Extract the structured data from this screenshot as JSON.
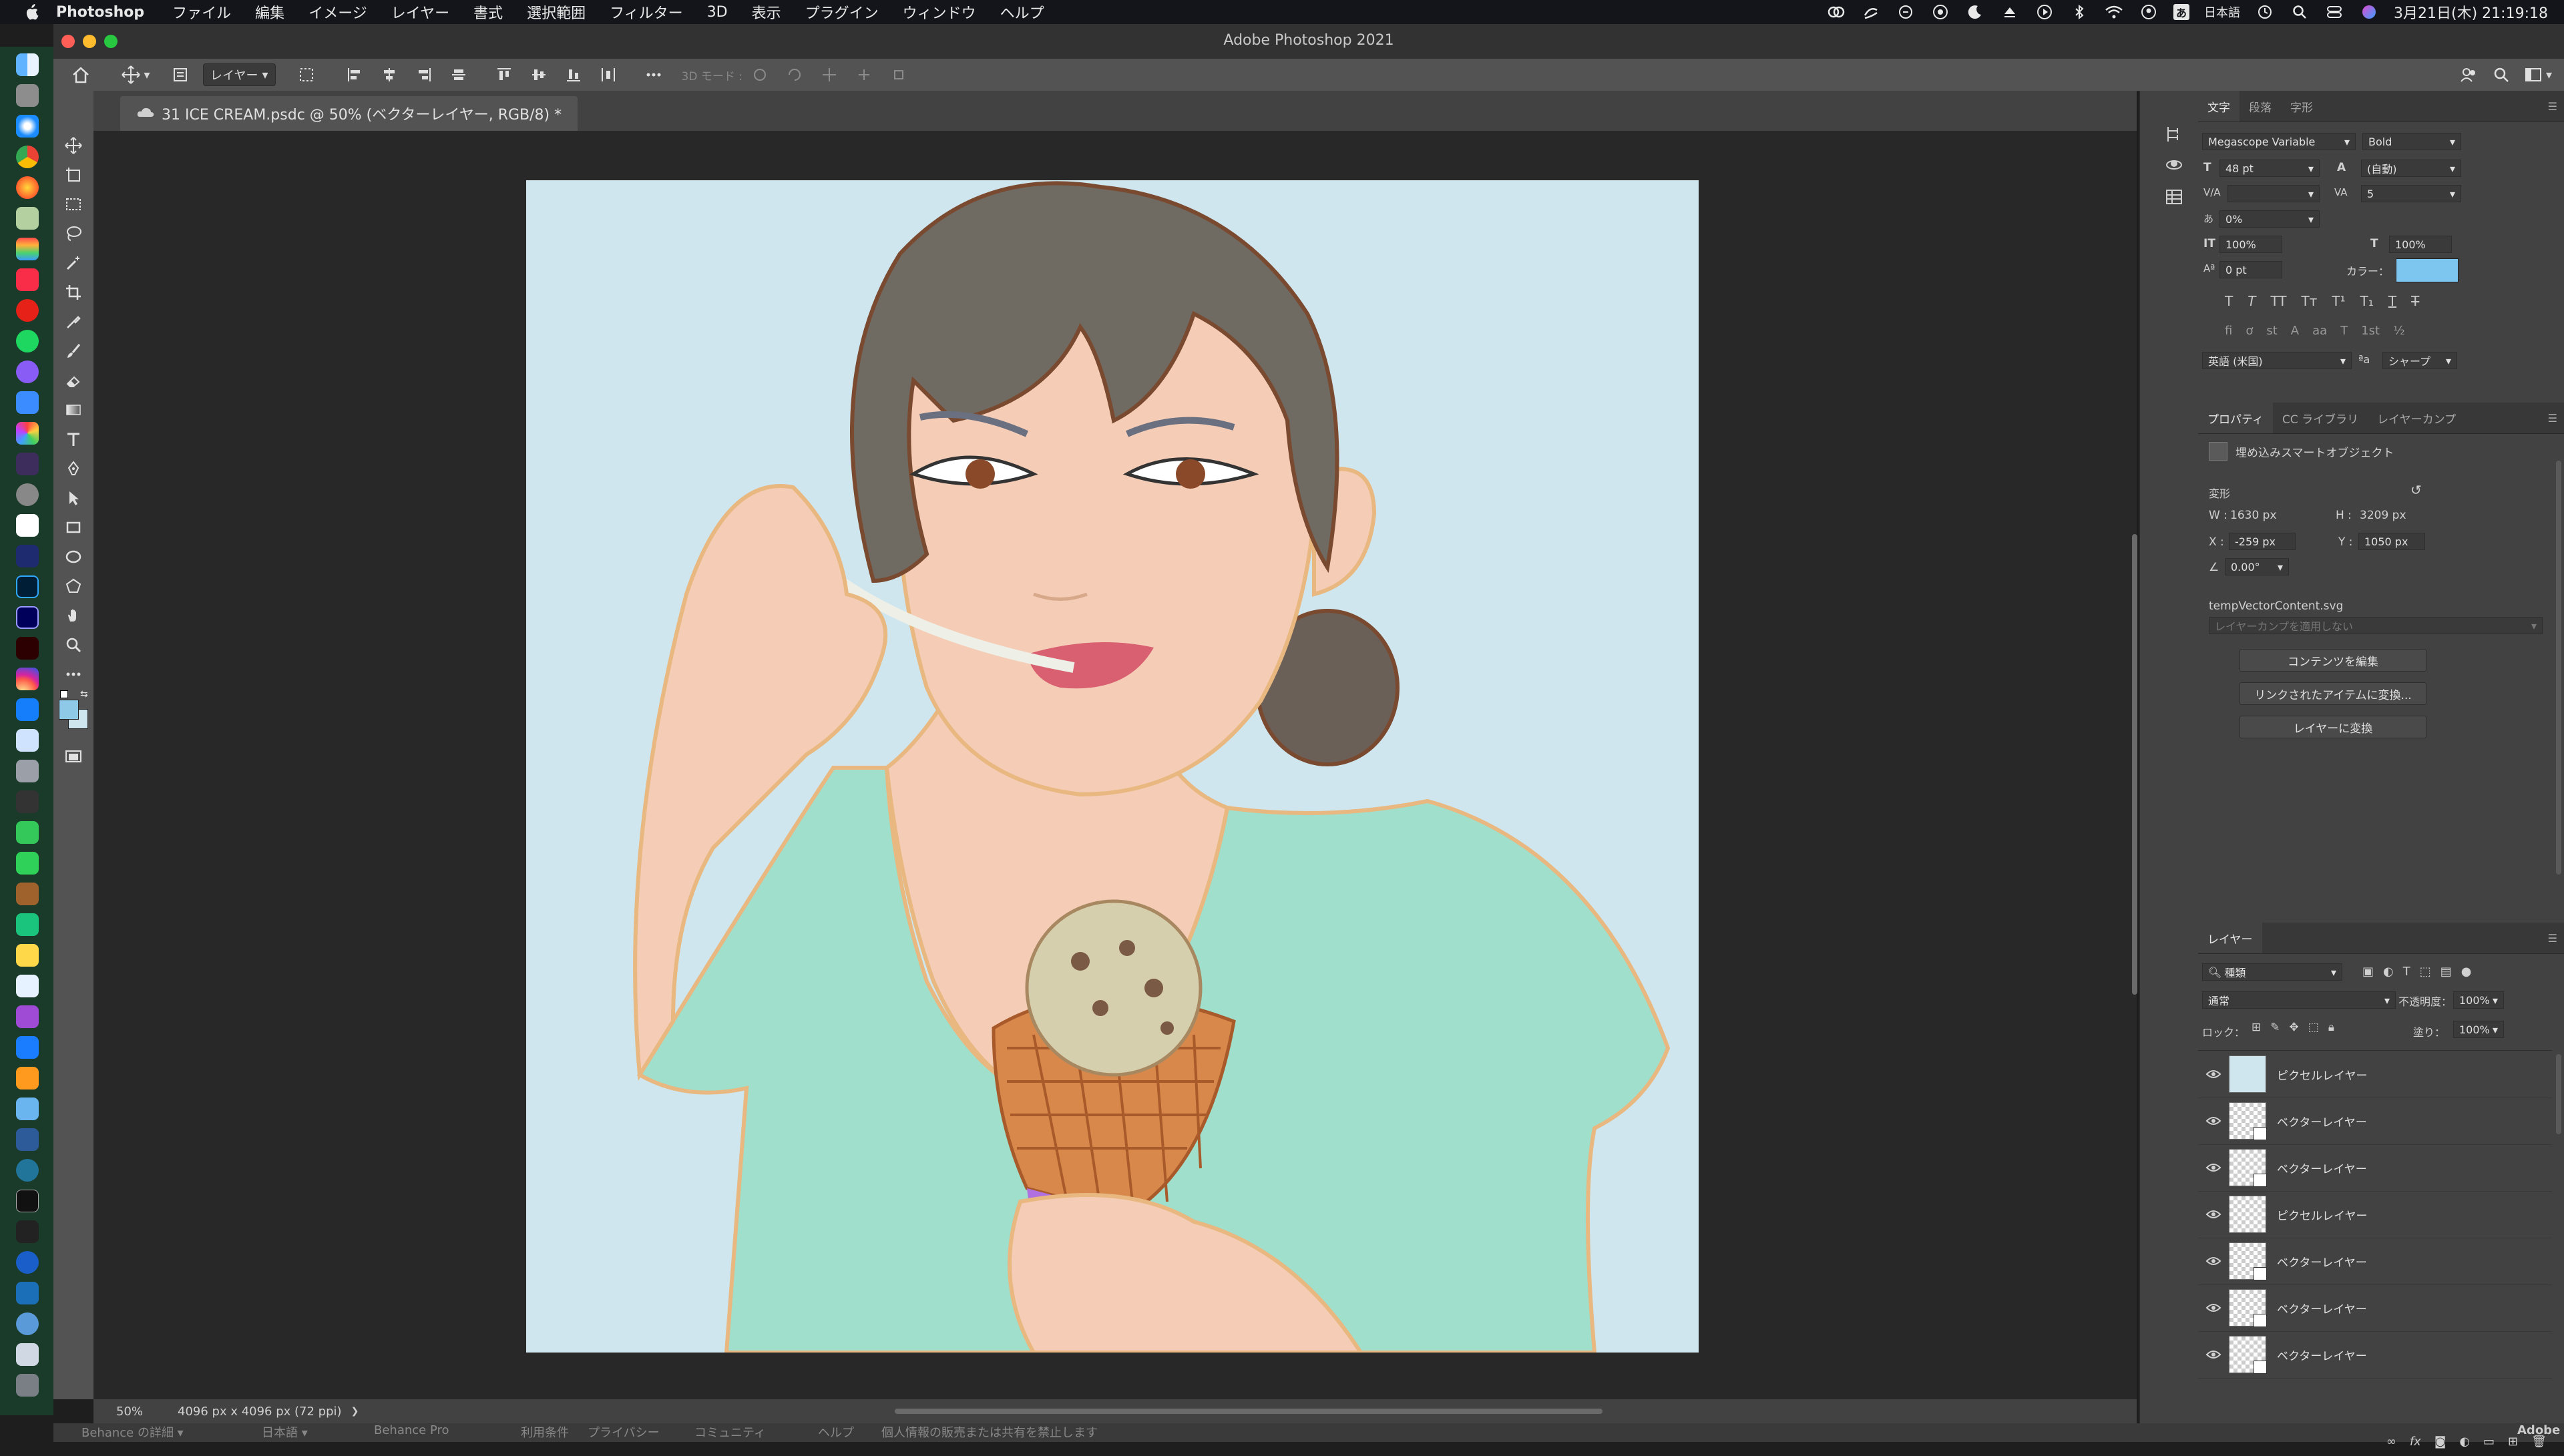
{
  "menubar": {
    "app_name": "Photoshop",
    "items": [
      "ファイル",
      "編集",
      "イメージ",
      "レイヤー",
      "書式",
      "選択範囲",
      "フィルター",
      "3D",
      "表示",
      "プラグイン",
      "ウィンドウ",
      "ヘルプ"
    ],
    "input_method": "あ",
    "input_language": "日本語",
    "datetime": "3月21日(木) 21:19:18"
  },
  "window": {
    "title": "Adobe Photoshop 2021"
  },
  "options_bar": {
    "layer_select": "レイヤー",
    "mode_3d": "3D モード :"
  },
  "document": {
    "tab_title": "31 ICE CREAM.psdc @ 50% (ベクターレイヤー, RGB/8) *",
    "zoom": "50%",
    "doc_info": "4096 px x 4096 px (72 ppi)"
  },
  "behance_footer": {
    "items": [
      "Behance の詳細 ▾",
      "日本語 ▾",
      "Behance Pro",
      "利用条件",
      "プライバシー",
      "コミュニティ",
      "ヘルプ",
      "個人情報の販売または共有を禁止します"
    ],
    "logo": "Adobe"
  },
  "character_panel": {
    "tabs": [
      "文字",
      "段落",
      "字形"
    ],
    "font_family": "Megascope Variable",
    "font_style": "Bold",
    "font_size": "48 pt",
    "leading": "(自動)",
    "kerning": "",
    "tracking": "5",
    "tsume": "0%",
    "vertical_scale": "100%",
    "horizontal_scale": "100%",
    "baseline_shift": "0 pt",
    "color_label": "カラー：",
    "color_value": "#7cc6f0",
    "language": "英語 (米国)",
    "aa_label": "ªa",
    "antialias": "シャープ"
  },
  "properties_panel": {
    "tabs": [
      "プロパティ",
      "CC ライブラリ",
      "レイヤーカンプ"
    ],
    "type": "埋め込みスマートオブジェクト",
    "transform_label": "変形",
    "w_label": "W :",
    "w": "1630 px",
    "h_label": "H :",
    "h": "3209 px",
    "x_label": "X :",
    "x": "-259 px",
    "y_label": "Y :",
    "y": "1050 px",
    "angle": "0.00°",
    "filename": "tempVectorContent.svg",
    "layer_comp_placeholder": "レイヤーカンプを適用しない",
    "buttons": [
      "コンテンツを編集",
      "リンクされたアイテムに変換...",
      "レイヤーに変換"
    ]
  },
  "layers_panel": {
    "title": "レイヤー",
    "filter": "種類",
    "blend_mode": "通常",
    "opacity_label": "不透明度：",
    "opacity": "100%",
    "lock_label": "ロック：",
    "fill_label": "塗り：",
    "fill": "100%",
    "layers": [
      {
        "name": "ピクセルレイヤー"
      },
      {
        "name": "ベクターレイヤー"
      },
      {
        "name": "ベクターレイヤー"
      },
      {
        "name": "ピクセルレイヤー"
      },
      {
        "name": "ベクターレイヤー"
      },
      {
        "name": "ベクターレイヤー"
      },
      {
        "name": "ベクターレイヤー"
      }
    ]
  },
  "colors": {
    "canvas_bg": "#cfe6ee",
    "foreground": "#8ec9e8"
  }
}
